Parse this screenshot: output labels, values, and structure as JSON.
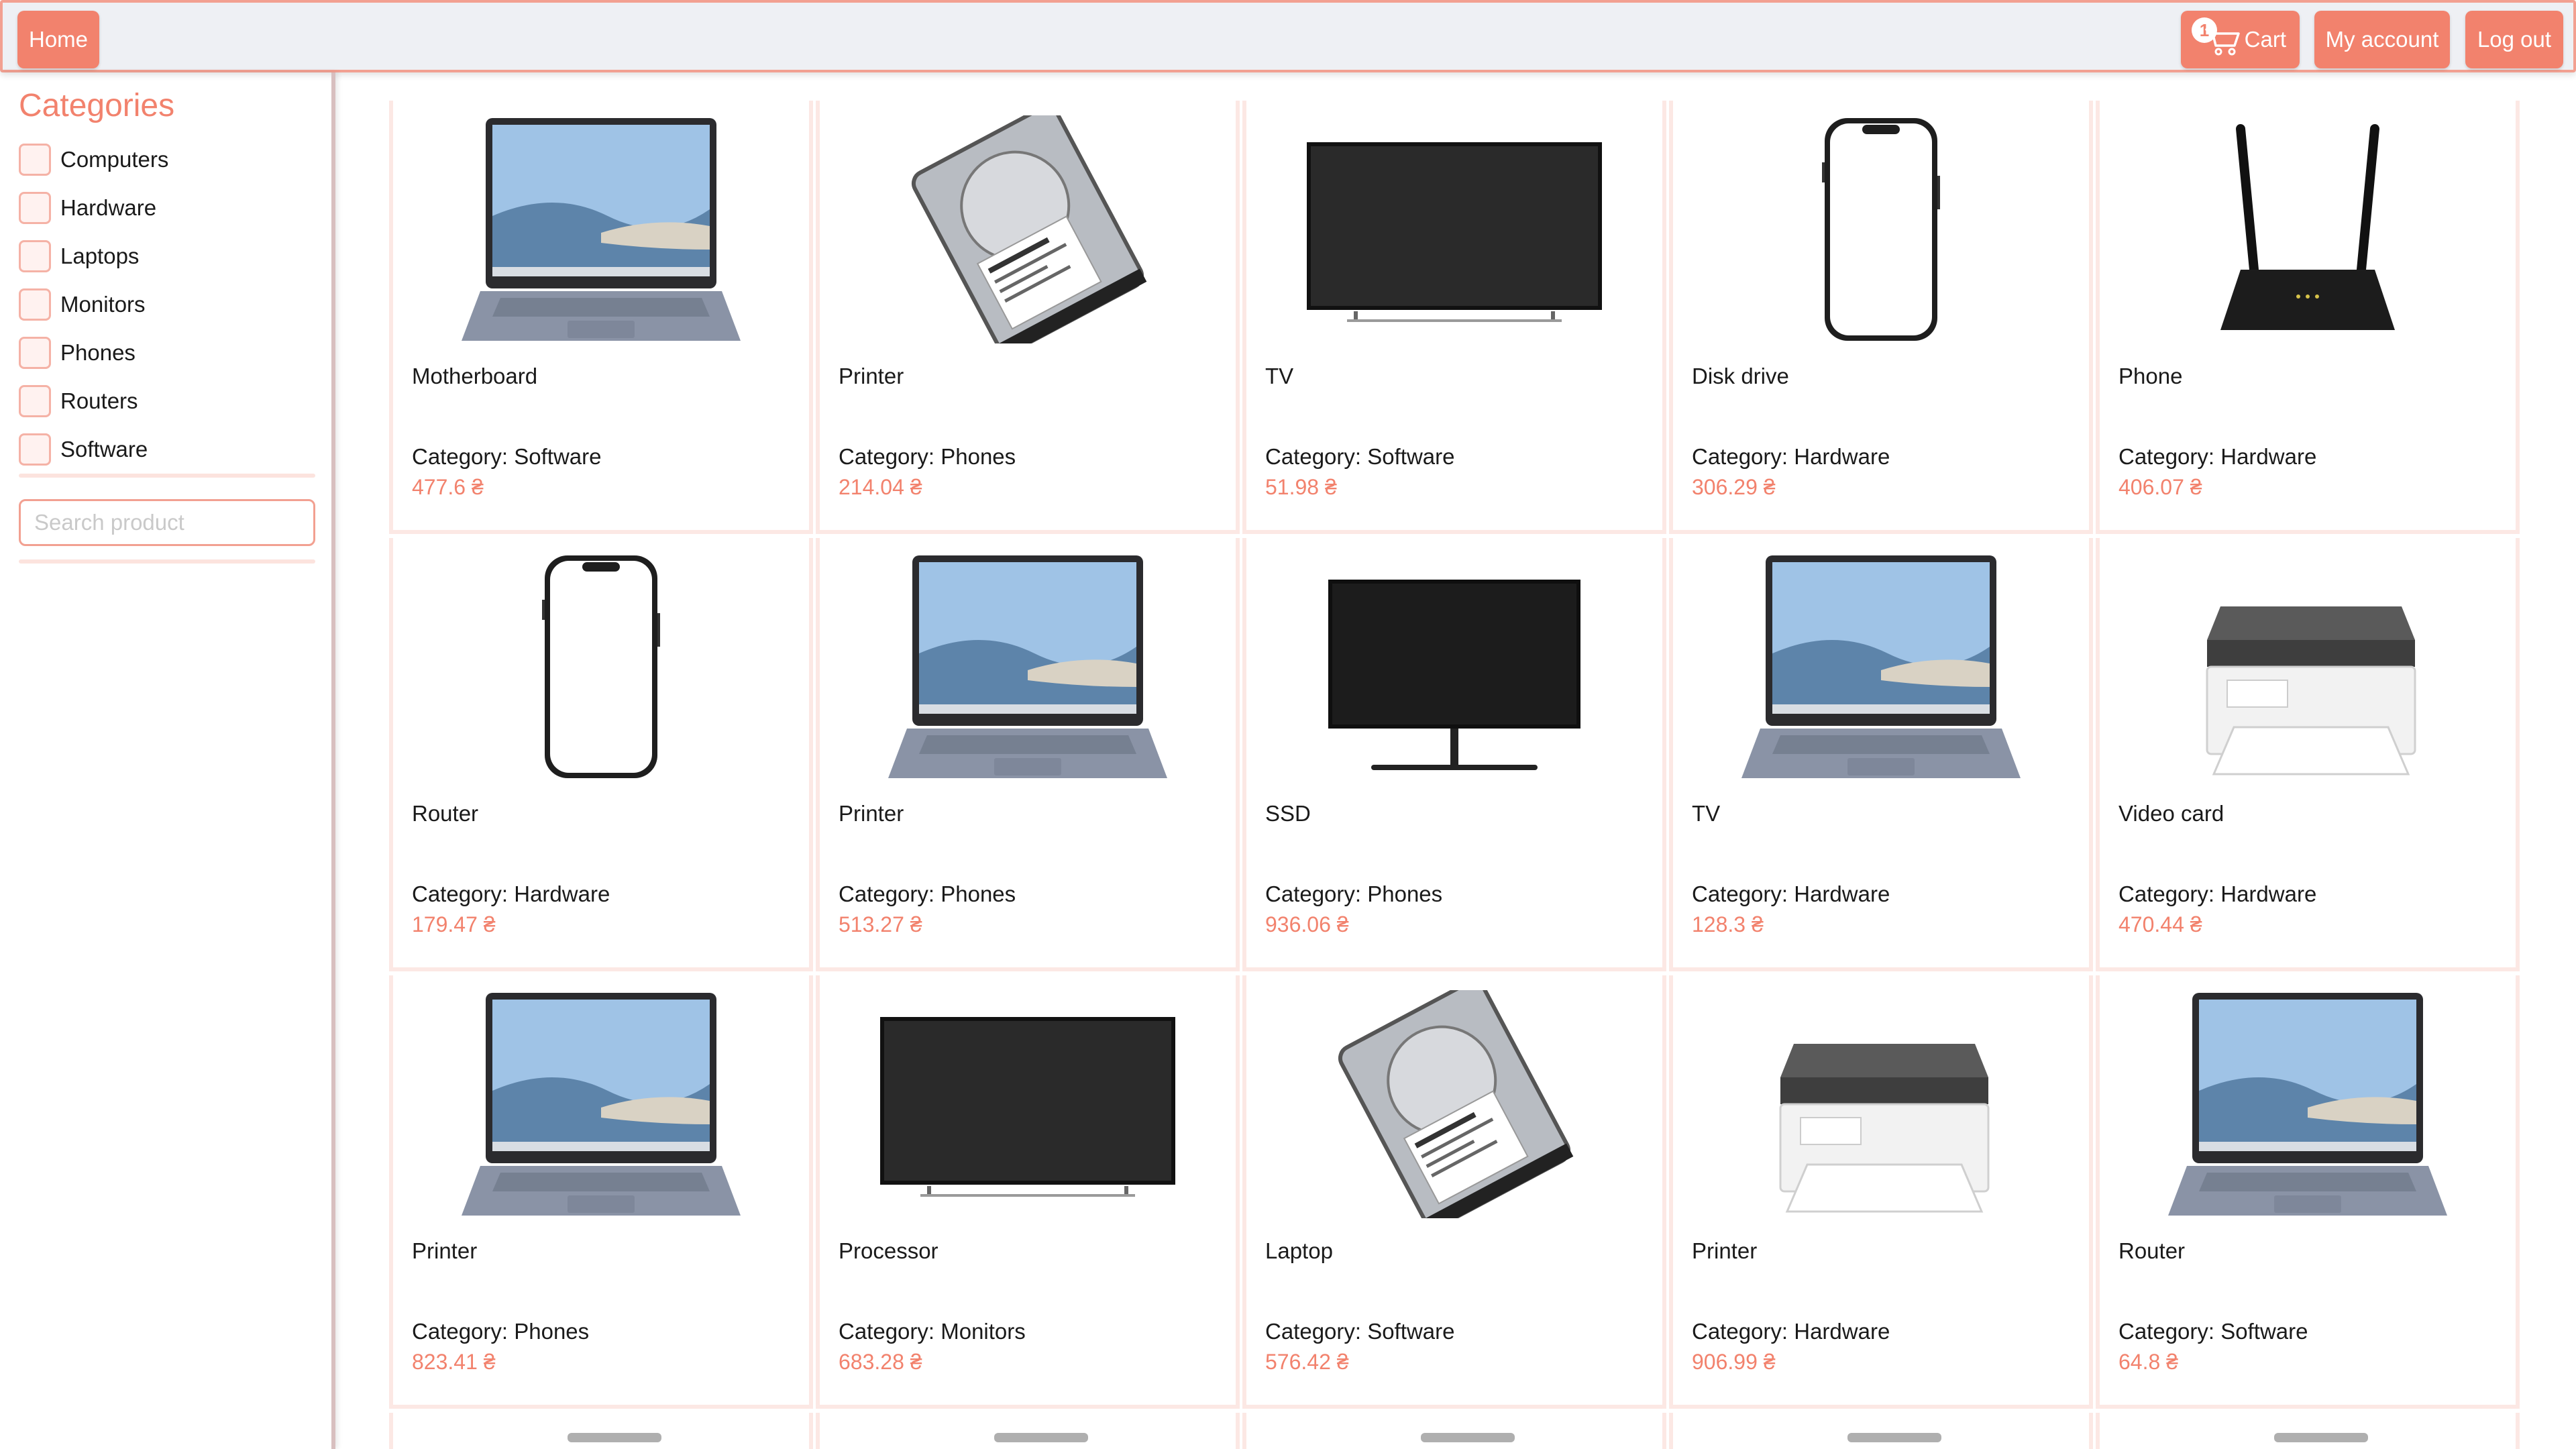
{
  "topbar": {
    "home_label": "Home",
    "cart_label": "Cart",
    "cart_count": "1",
    "account_label": "My account",
    "logout_label": "Log out"
  },
  "sidebar": {
    "title": "Categories",
    "categories": [
      "Computers",
      "Hardware",
      "Laptops",
      "Monitors",
      "Phones",
      "Routers",
      "Software"
    ],
    "search_placeholder": "Search product"
  },
  "products": [
    {
      "name": "Motherboard",
      "category": "Category: Software",
      "price": "477.6 ₴",
      "image": "laptop-image"
    },
    {
      "name": "Printer",
      "category": "Category: Phones",
      "price": "214.04 ₴",
      "image": "hard-drive-image"
    },
    {
      "name": "TV",
      "category": "Category: Software",
      "price": "51.98 ₴",
      "image": "tv-image"
    },
    {
      "name": "Disk drive",
      "category": "Category: Hardware",
      "price": "306.29 ₴",
      "image": "phone-image"
    },
    {
      "name": "Phone",
      "category": "Category: Hardware",
      "price": "406.07 ₴",
      "image": "router-image"
    },
    {
      "name": "Router",
      "category": "Category: Hardware",
      "price": "179.47 ₴",
      "image": "phone-image"
    },
    {
      "name": "Printer",
      "category": "Category: Phones",
      "price": "513.27 ₴",
      "image": "laptop-image"
    },
    {
      "name": "SSD",
      "category": "Category: Phones",
      "price": "936.06 ₴",
      "image": "monitor-image"
    },
    {
      "name": "TV",
      "category": "Category: Hardware",
      "price": "128.3 ₴",
      "image": "laptop-image"
    },
    {
      "name": "Video card",
      "category": "Category: Hardware",
      "price": "470.44 ₴",
      "image": "printer-image"
    },
    {
      "name": "Printer",
      "category": "Category: Phones",
      "price": "823.41 ₴",
      "image": "laptop-image"
    },
    {
      "name": "Processor",
      "category": "Category: Monitors",
      "price": "683.28 ₴",
      "image": "tv-image"
    },
    {
      "name": "Laptop",
      "category": "Category: Software",
      "price": "576.42 ₴",
      "image": "hard-drive-image"
    },
    {
      "name": "Printer",
      "category": "Category: Hardware",
      "price": "906.99 ₴",
      "image": "printer-image"
    },
    {
      "name": "Router",
      "category": "Category: Software",
      "price": "64.8 ₴",
      "image": "laptop-image"
    }
  ],
  "colors": {
    "accent": "#f2826d",
    "topbar_bg": "#eef0f4",
    "card_border": "#fce8e4",
    "checkbox_fill": "#fff2f0"
  }
}
